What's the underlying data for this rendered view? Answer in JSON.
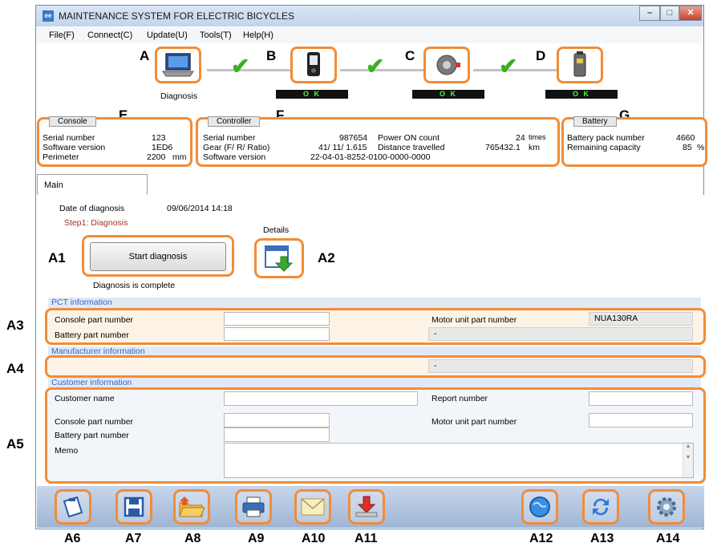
{
  "window": {
    "title": "MAINTENANCE SYSTEM FOR ELECTRIC BICYCLES",
    "minimize": "–",
    "maximize": "□",
    "close": "✕"
  },
  "menu": [
    "File(F)",
    "Connect(C)",
    "Update(U)",
    "Tools(T)",
    "Help(H)"
  ],
  "devices": {
    "a": {
      "callout": "A",
      "label": "Diagnosis",
      "icon": "laptop-icon"
    },
    "b": {
      "callout": "B",
      "status": "O K",
      "icon": "console-display-icon"
    },
    "c": {
      "callout": "C",
      "status": "O K",
      "icon": "motor-unit-icon"
    },
    "d": {
      "callout": "D",
      "status": "O K",
      "icon": "battery-icon"
    }
  },
  "console": {
    "callout": "E",
    "tab": "Console",
    "serial_label": "Serial number",
    "serial_value": "123",
    "sw_label": "Software version",
    "sw_value": "1ED6",
    "perimeter_label": "Perimeter",
    "perimeter_value": "2200",
    "perimeter_unit": "mm"
  },
  "controller": {
    "callout": "F",
    "tab": "Controller",
    "serial_label": "Serial number",
    "serial_value": "987654",
    "gear_label": "Gear (F/ R/ Ratio)",
    "gear_value": "41/ 11/ 1.615",
    "sw_label": "Software version",
    "sw_value": "22-04-01-8252-0100-0000-0000",
    "power_label": "Power ON count",
    "power_value": "24",
    "power_unit": "times",
    "distance_label": "Distance travelled",
    "distance_value": "765432.1",
    "distance_unit": "km"
  },
  "battery": {
    "callout": "G",
    "tab": "Battery",
    "pack_label": "Battery pack number",
    "pack_value": "4660",
    "capacity_label": "Remaining capacity",
    "capacity_value": "85",
    "capacity_unit": "%"
  },
  "main": {
    "tab": "Main",
    "date_label": "Date of diagnosis",
    "date_value": "09/06/2014  14:18",
    "step": "Step1: Diagnosis",
    "start_button": "Start diagnosis",
    "start_callout": "A1",
    "details_label": "Details",
    "details_callout": "A2",
    "complete": "Diagnosis is complete"
  },
  "pct": {
    "heading": "PCT information",
    "callout": "A3",
    "console_part_label": "Console part number",
    "battery_part_label": "Battery part number",
    "motor_part_label": "Motor unit part number",
    "motor_part_value": "NUA130RA",
    "dash": "-"
  },
  "manufacturer": {
    "heading": "Manufacturer information",
    "callout": "A4",
    "dash": "-"
  },
  "customer": {
    "heading": "Customer information",
    "callout": "A5",
    "name_label": "Customer name",
    "report_label": "Report number",
    "console_part_label": "Console part number",
    "motor_part_label": "Motor unit part number",
    "battery_part_label": "Battery part number",
    "memo_label": "Memo"
  },
  "toolbar_labels": [
    "A6",
    "A7",
    "A8",
    "A9",
    "A10",
    "A11",
    "A12",
    "A13",
    "A14"
  ],
  "toolbar_icons": [
    "clipboard-icon",
    "save-icon",
    "open-folder-icon",
    "print-icon",
    "mail-icon",
    "download-icon",
    "globe-icon",
    "refresh-icon",
    "settings-gear-icon"
  ],
  "colors": {
    "highlight": "#f28c38",
    "ok_text": "#3cff3c",
    "section_heading": "#3366cc",
    "check": "#3ab021"
  }
}
